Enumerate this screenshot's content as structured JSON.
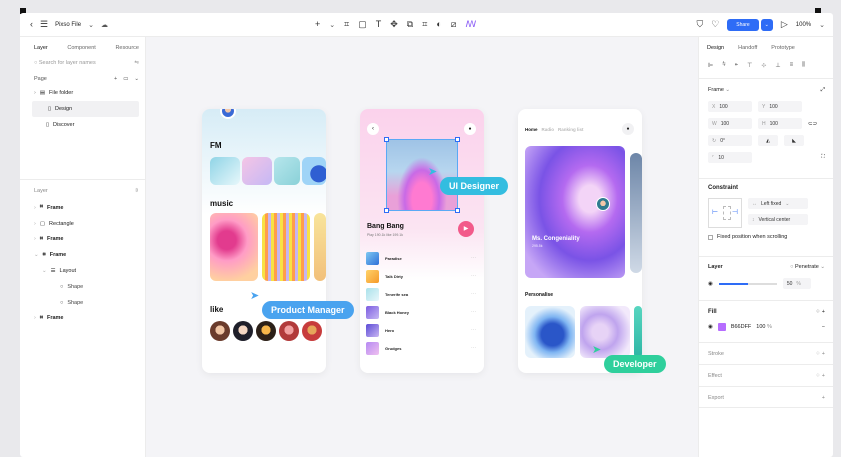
{
  "topbar": {
    "file_name": "Pixso File",
    "share_label": "Share",
    "zoom": "100%"
  },
  "left_panel": {
    "tabs": [
      "Layer",
      "Component",
      "Resource"
    ],
    "search_placeholder": "Search for layer names",
    "page_label": "Page",
    "pages": {
      "folder": "File folder",
      "design": "Design",
      "discover": "Discover"
    },
    "layer_label": "Layer",
    "layers": {
      "frame1": "Frame",
      "rectangle": "Rectangle",
      "frame2": "Frame",
      "frame3": "Frame",
      "layout": "Layout",
      "shape1": "Shape",
      "shape2": "Shape",
      "frame4": "Frame"
    }
  },
  "canvas": {
    "phone1": {
      "fm": "FM",
      "music": "music",
      "like": "like"
    },
    "phone2": {
      "song_title": "Bang Bang",
      "song_meta": "Play 190.1k   like 199.1k",
      "songs": [
        "Paradise",
        "Talk Dirty",
        "Tenerife sea",
        "Black Honey",
        "Hero",
        "Grudges"
      ]
    },
    "phone3": {
      "tabs": [
        "Home",
        "Radio",
        "Ranking list"
      ],
      "featured": "Ms. Congeniality",
      "featured_sub": "295.5k",
      "personalise": "Personalise"
    },
    "tags": {
      "product_manager": "Product Manager",
      "ui_designer": "UI Designer",
      "developer": "Developer"
    }
  },
  "right_panel": {
    "tabs": [
      "Design",
      "Handoff",
      "Prototype"
    ],
    "frame_label": "Frame",
    "x": "100",
    "y": "100",
    "w": "100",
    "h": "100",
    "rotation": "0°",
    "radius": "10",
    "constraint_title": "Constraint",
    "constraint_h": "Left fixed",
    "constraint_v": "Vertical center",
    "fixed_position": "Fixed position when scrolling",
    "layer_title": "Layer",
    "blend": "Penetrate",
    "opacity": "50",
    "fill_title": "Fill",
    "fill_hex": "B66DFF",
    "fill_opacity": "100",
    "stroke_title": "Stroke",
    "effect_title": "Effect",
    "export_title": "Export"
  },
  "colors": {
    "accent": "#2e6cf6",
    "fill": "#B66DFF",
    "tag_blue": "#4aa3ef",
    "tag_cyan": "#33bde0",
    "tag_green": "#2fcf9c"
  }
}
